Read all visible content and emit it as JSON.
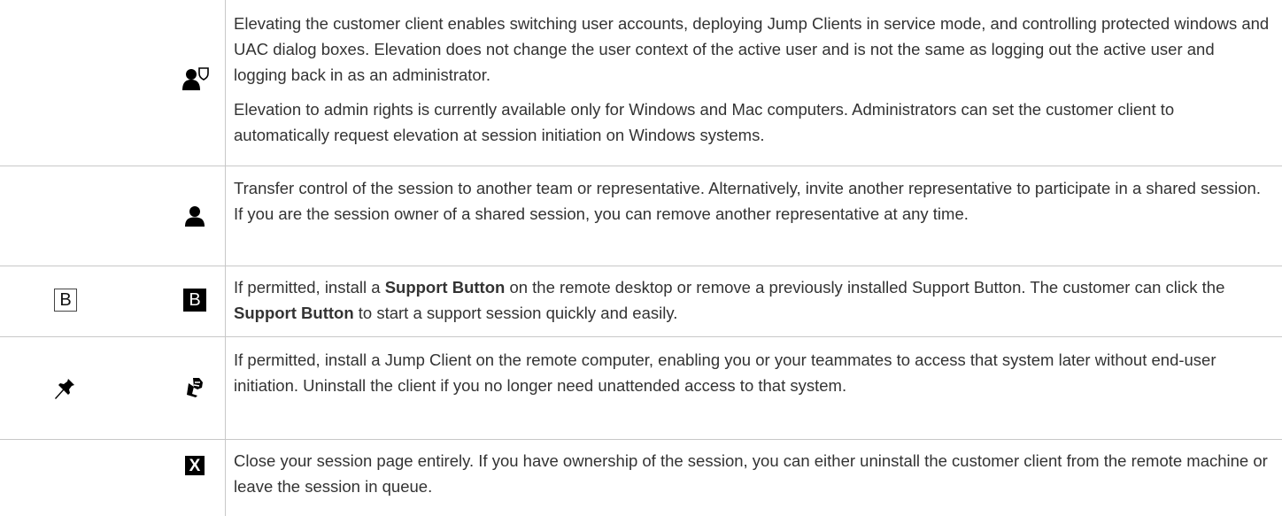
{
  "rows": [
    {
      "paragraphs": [
        "Elevating the customer client enables switching user accounts, deploying Jump Clients in service mode, and controlling protected windows and UAC dialog boxes. Elevation does not change the user context of the active user and is not the same as logging out the active user and logging back in as an administrator.",
        "Elevation to admin rights is currently available only for Windows and Mac computers. Administrators can set the customer client to automatically request elevation at session initiation on Windows systems."
      ],
      "icons": [
        "user-shield-icon"
      ]
    },
    {
      "paragraphs": [
        "Transfer control of the session to another team or representative. Alternatively, invite another representative to participate in a shared session. If you are the session owner of a shared session, you can remove another representative at any time."
      ],
      "icons": [
        "user-icon"
      ]
    },
    {
      "text_1": "If permitted, install a ",
      "bold_1": "Support Button",
      "text_2": " on the remote desktop or remove a previously installed Support Button. The customer can click the ",
      "bold_2": "Support Button",
      "text_3": " to start a support session quickly and easily.",
      "icon_letter": "B",
      "icons": [
        "support-button-install-icon",
        "support-button-remove-icon"
      ]
    },
    {
      "paragraphs": [
        "If permitted, install a Jump Client on the remote computer, enabling you or your teammates to access that system later without end-user initiation. Uninstall the client if you no longer need unattended access to that system."
      ],
      "icons": [
        "pin-icon",
        "unpin-icon"
      ]
    },
    {
      "paragraphs": [
        "Close your session page entirely. If you have ownership of the session, you can either uninstall the customer client from the remote machine or leave the session in queue."
      ],
      "icon_letter": "X",
      "icons": [
        "close-icon"
      ]
    }
  ],
  "colors": {
    "text": "#333333",
    "rule": "#c8c8c8",
    "icon": "#000000"
  }
}
